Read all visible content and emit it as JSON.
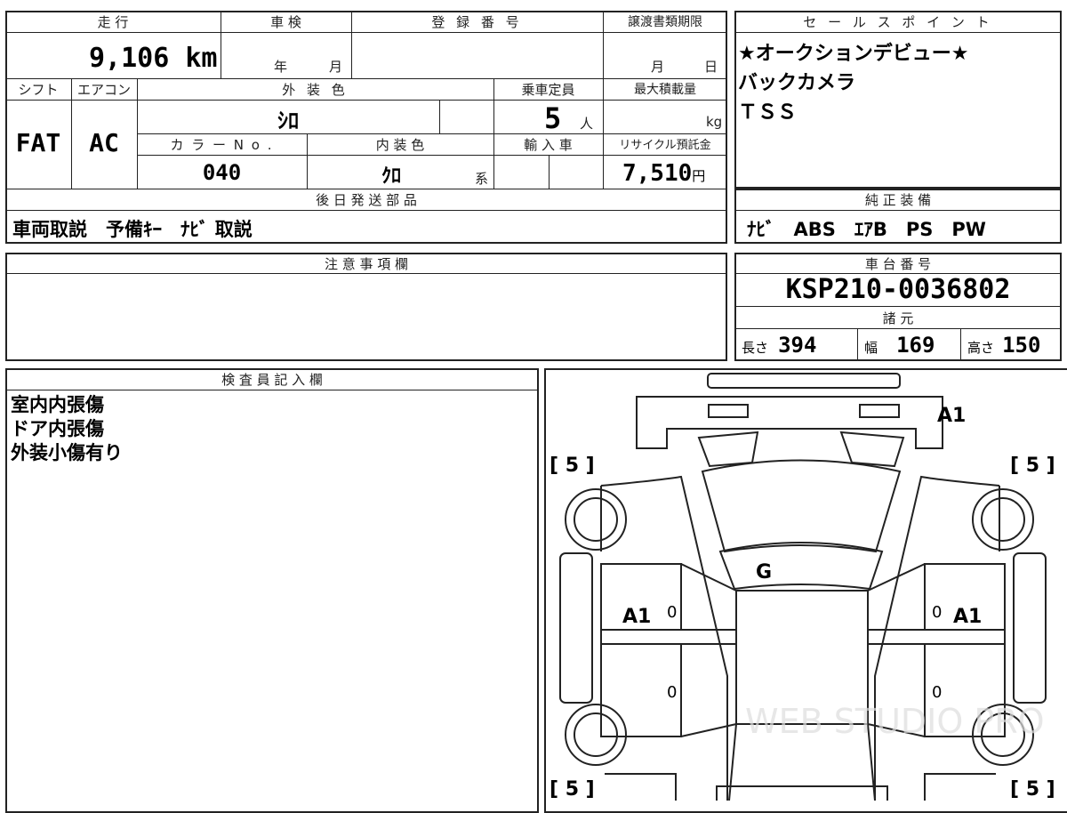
{
  "specs": {
    "mileage_header": "走 行",
    "mileage_value": "9,106",
    "mileage_unit": "km",
    "inspection_header": "車 検",
    "inspection_year": "年",
    "inspection_month": "月",
    "registration_header": "登 録 番 号",
    "transfer_header": "譲渡書類期限",
    "transfer_month": "月",
    "transfer_day": "日",
    "shift_header": "シフト",
    "shift_value": "FAT",
    "ac_header": "エアコン",
    "ac_value": "AC",
    "exterior_header": "外 装 色",
    "exterior_value": "ｼﾛ",
    "capacity_header": "乗車定員",
    "capacity_value": "5",
    "capacity_unit": "人",
    "maxload_header": "最大積載量",
    "maxload_unit": "kg",
    "color_no_header": "カ ラ ー N o .",
    "color_no_value": "040",
    "interior_header": "内 装 色",
    "interior_value": "ｸﾛ",
    "interior_suffix": "系",
    "import_header": "輸 入 車",
    "recycle_header": "リサイクル預託金",
    "recycle_value": "7,510",
    "recycle_unit": "円",
    "later_parts_header": "後 日 発 送 部 品",
    "later_parts_value": "車両取説　予備ｷｰ　ﾅﾋﾞ 取説"
  },
  "sales_points": {
    "header": "セ ー ル ス ポ イ ン ト",
    "lines": [
      "★オークションデビュー★",
      "バックカメラ",
      "ＴＳＳ"
    ]
  },
  "equipment": {
    "header": "純 正 装 備",
    "value": "ﾅﾋﾞ　ABS　ｴｱB　PS　PW"
  },
  "notes": {
    "header": "注 意 事 項 欄",
    "value": ""
  },
  "chassis": {
    "header": "車 台 番 号",
    "value": "KSP210-0036802",
    "dims_header": "諸 元",
    "length_label": "長さ",
    "length_value": "394",
    "width_label": "幅",
    "width_value": "169",
    "height_label": "高さ",
    "height_value": "150"
  },
  "inspector": {
    "header": "検 査 員 記 入 欄",
    "lines": [
      "室内内張傷",
      "ドア内張傷",
      "外装小傷有り"
    ]
  },
  "diagram": {
    "tire_tl": "[ 5 ]",
    "tire_tr": "[ 5 ]",
    "tire_bl": "[ 5 ]",
    "tire_br": "[ 5 ]",
    "mark_bumper": "A1",
    "mark_windshield": "G",
    "mark_left_door": "A1",
    "mark_right_door": "A1",
    "zero_1": "0",
    "zero_2": "0",
    "zero_3": "0",
    "zero_4": "0",
    "watermark": "WEB STUDIO PRO"
  }
}
